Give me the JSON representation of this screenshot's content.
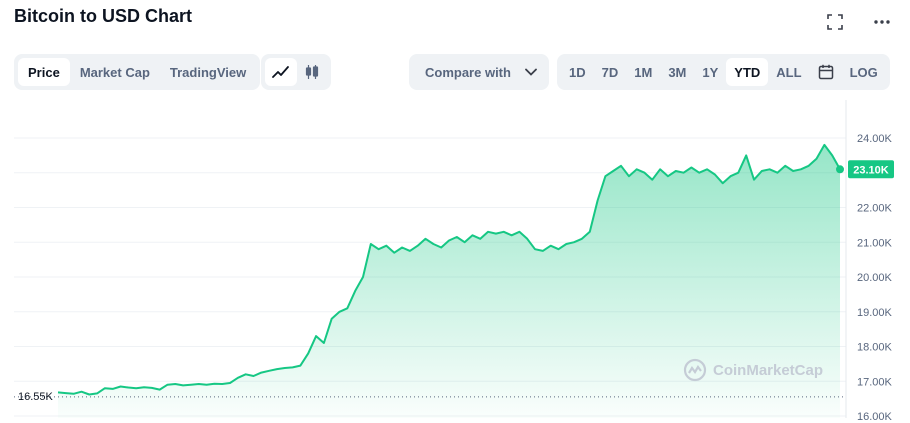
{
  "header": {
    "title": "Bitcoin to USD Chart"
  },
  "icons": {
    "fullscreen": "fullscreen-icon",
    "more": "more-icon"
  },
  "toolbar": {
    "type_tabs": [
      {
        "label": "Price",
        "active": true
      },
      {
        "label": "Market Cap",
        "active": false
      },
      {
        "label": "TradingView",
        "active": false
      }
    ],
    "chart_types": [
      {
        "icon": "line-chart-icon",
        "active": true
      },
      {
        "icon": "candlestick-icon",
        "active": false
      }
    ],
    "compare": {
      "label": "Compare with",
      "icon": "chevron-down-icon"
    },
    "ranges": [
      {
        "label": "1D",
        "active": false
      },
      {
        "label": "7D",
        "active": false
      },
      {
        "label": "1M",
        "active": false
      },
      {
        "label": "3M",
        "active": false
      },
      {
        "label": "1Y",
        "active": false
      },
      {
        "label": "YTD",
        "active": true
      }
    ],
    "range_all": {
      "label": "ALL",
      "active": false
    },
    "calendar": {
      "icon": "calendar-icon"
    },
    "log": {
      "label": "LOG"
    }
  },
  "watermark": {
    "text": "CoinMarketCap"
  },
  "colors": {
    "line": "#16c784",
    "area_top": "#16c784",
    "text_muted": "#58667e",
    "grid": "#eff2f5"
  },
  "chart_data": {
    "type": "area",
    "title": "Bitcoin to USD Chart",
    "xlabel": "",
    "ylabel": "",
    "ylim": [
      16000,
      24500
    ],
    "yticks": [
      16000,
      17000,
      18000,
      19000,
      20000,
      21000,
      22000,
      23000,
      24000
    ],
    "ytick_labels": [
      "16.00K",
      "17.00K",
      "18.00K",
      "19.00K",
      "20.00K",
      "21.00K",
      "22.00K",
      "23.00K",
      "24.00K"
    ],
    "baseline": {
      "value": 16550,
      "label": "16.55K"
    },
    "current": {
      "value": 23100,
      "label": "23.10K"
    },
    "grid": true,
    "series": [
      {
        "x": [
          0,
          1,
          2,
          3,
          4,
          5,
          6,
          7,
          8,
          9,
          10,
          11,
          12,
          13,
          14,
          15,
          16,
          17,
          18,
          19,
          20,
          21,
          22,
          23,
          24,
          25,
          26,
          27,
          28,
          29,
          30,
          31,
          32,
          33,
          34,
          35,
          36,
          37,
          38,
          39,
          40,
          41,
          42,
          43,
          44,
          45,
          46,
          47,
          48,
          49,
          50,
          51,
          52,
          53,
          54,
          55,
          56,
          57,
          58,
          59,
          60,
          61,
          62,
          63,
          64,
          65,
          66,
          67,
          68,
          69,
          70,
          71,
          72,
          73,
          74,
          75,
          76,
          77,
          78,
          79,
          80,
          81,
          82,
          83,
          84,
          85,
          86,
          87,
          88,
          89,
          90,
          91,
          92,
          93,
          94,
          95,
          96,
          97,
          98,
          99,
          100
        ],
        "values": [
          16680,
          16660,
          16640,
          16700,
          16620,
          16650,
          16800,
          16780,
          16850,
          16820,
          16800,
          16830,
          16810,
          16760,
          16900,
          16920,
          16880,
          16900,
          16920,
          16900,
          16930,
          16920,
          16950,
          17100,
          17200,
          17150,
          17250,
          17300,
          17350,
          17380,
          17400,
          17450,
          17800,
          18300,
          18100,
          18800,
          19000,
          19100,
          19600,
          20000,
          20950,
          20800,
          20900,
          20700,
          20850,
          20750,
          20900,
          21100,
          20950,
          20850,
          21050,
          21150,
          21000,
          21200,
          21100,
          21300,
          21250,
          21300,
          21200,
          21300,
          21100,
          20800,
          20750,
          20900,
          20800,
          20950,
          21000,
          21100,
          21300,
          22200,
          22900,
          23050,
          23200,
          22900,
          23100,
          23000,
          22800,
          23100,
          22900,
          23050,
          23000,
          23150,
          23000,
          23100,
          22950,
          22700,
          22900,
          23000,
          23500,
          22800,
          23050,
          23100,
          23000,
          23200,
          23050,
          23100,
          23200,
          23400,
          23800,
          23500,
          23100
        ]
      }
    ]
  }
}
